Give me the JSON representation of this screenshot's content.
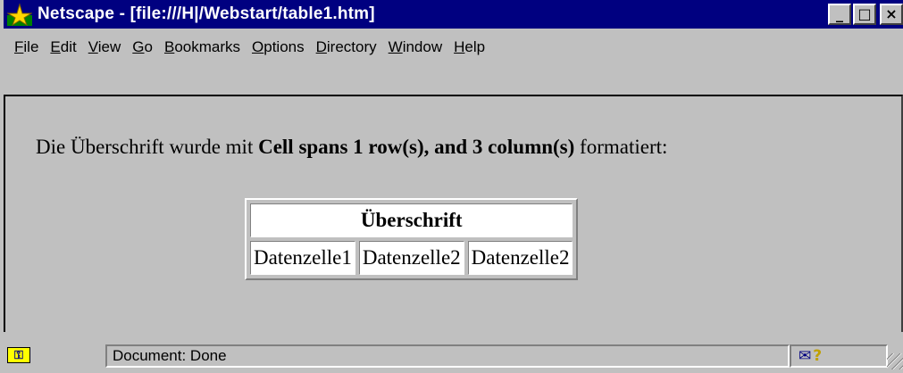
{
  "window": {
    "title": "Netscape - [file:///H|/Webstart/table1.htm]",
    "minimize_glyph": "_",
    "maximize_glyph": "□",
    "close_glyph": "×"
  },
  "menu": [
    {
      "mnemonic": "F",
      "rest": "ile"
    },
    {
      "mnemonic": "E",
      "rest": "dit"
    },
    {
      "mnemonic": "V",
      "rest": "iew"
    },
    {
      "mnemonic": "G",
      "rest": "o"
    },
    {
      "mnemonic": "B",
      "rest": "ookmarks"
    },
    {
      "mnemonic": "O",
      "rest": "ptions"
    },
    {
      "mnemonic": "D",
      "rest": "irectory"
    },
    {
      "mnemonic": "W",
      "rest": "indow"
    },
    {
      "mnemonic": "H",
      "rest": "elp"
    }
  ],
  "content": {
    "sentence_pre": "Die Überschrift wurde mit ",
    "sentence_bold": "Cell spans 1 row(s), and 3 column(s)",
    "sentence_post": " formatiert:",
    "table": {
      "header": "Überschrift",
      "cells": [
        "Datenzelle1",
        "Datenzelle2",
        "Datenzelle2"
      ]
    }
  },
  "status": {
    "text": "Document: Done",
    "security_icon": "key-lock-icon",
    "mail_icon": "envelope-icon",
    "help_icon": "question-icon",
    "security_glyph": "⚿",
    "mail_glyph": "✉",
    "help_glyph": "?"
  },
  "colors": {
    "titlebar": "#000080",
    "face": "#c0c0c0",
    "cell_bg": "#ffffff"
  }
}
